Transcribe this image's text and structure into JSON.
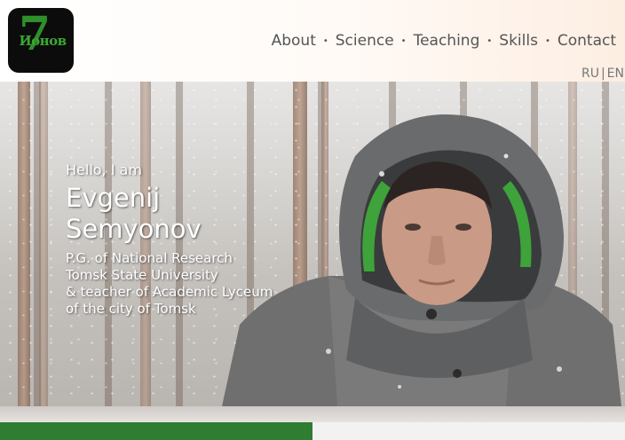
{
  "logo": {
    "digit": "7",
    "word": "Ионов"
  },
  "nav": {
    "items": [
      {
        "label": "About"
      },
      {
        "label": "Science"
      },
      {
        "label": "Teaching"
      },
      {
        "label": "Skills"
      },
      {
        "label": "Contact"
      }
    ],
    "separator": "•"
  },
  "lang": {
    "ru": "RU",
    "sep": "|",
    "en": "EN"
  },
  "hero": {
    "greeting": "Hello, I am",
    "name_line1": "Evgenij",
    "name_line2": "Semyonov",
    "subtitle_lines": [
      "P.G. of National Research",
      "Tomsk State University",
      "& teacher of Academic Lyceum",
      "of the city of Tomsk"
    ]
  },
  "colors": {
    "accent_green": "#2f7d32",
    "nav_text": "#555555"
  }
}
